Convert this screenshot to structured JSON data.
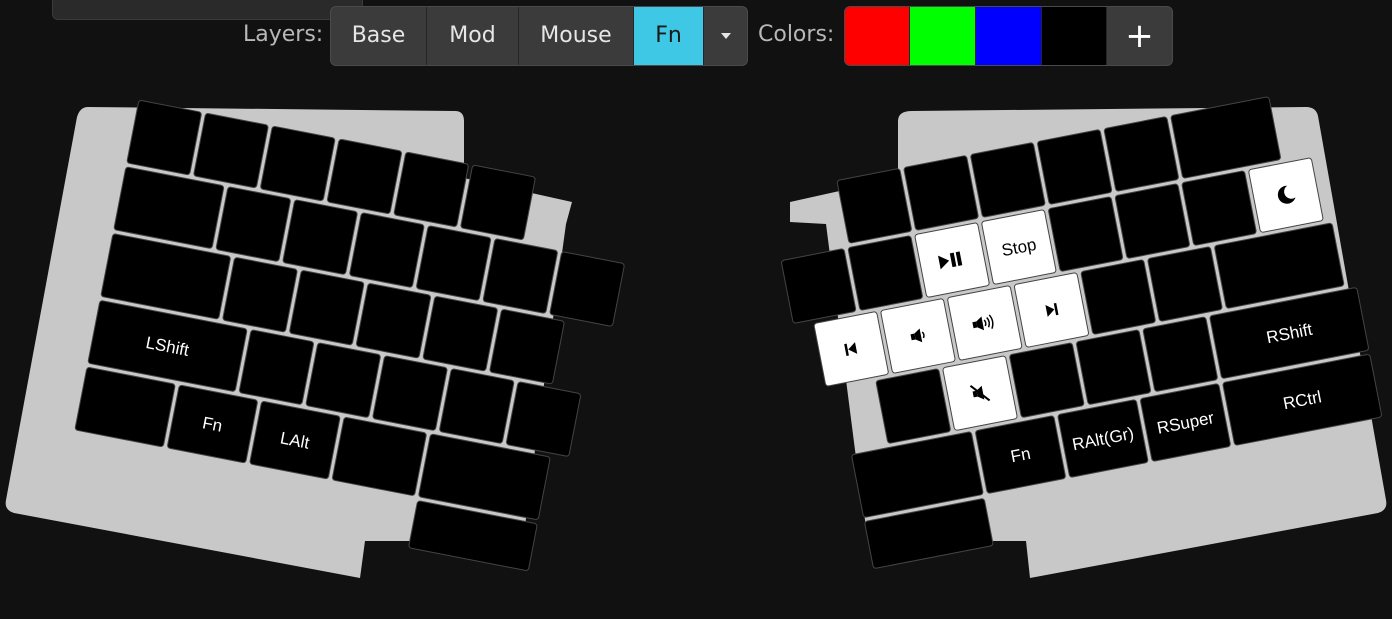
{
  "toolbar": {
    "layers_label": "Layers:",
    "layers": [
      "Base",
      "Mod",
      "Mouse",
      "Fn"
    ],
    "active_layer": "Fn",
    "colors_label": "Colors:",
    "colors": [
      "#ff0000",
      "#00ff00",
      "#0000ff",
      "#000000"
    ],
    "add_color_label": "+"
  },
  "keyboard": {
    "left_labels": {
      "lshift": "LShift",
      "fn": "Fn",
      "lalt": "LAlt"
    },
    "right_labels": {
      "stop": "Stop",
      "rshift": "RShift",
      "fn": "Fn",
      "ralt": "RAlt(Gr)",
      "rsuper": "RSuper",
      "rctrl": "RCtrl"
    },
    "icons": {
      "sleep": "moon-icon",
      "play_pause": "play-pause-icon",
      "prev": "previous-track-icon",
      "vol_down": "volume-down-icon",
      "vol_up": "volume-up-icon",
      "next": "next-track-icon",
      "mute": "mute-icon"
    },
    "key_color": "#000000",
    "highlight_color": "#ffffff",
    "plate_color": "#c8c8c8"
  }
}
